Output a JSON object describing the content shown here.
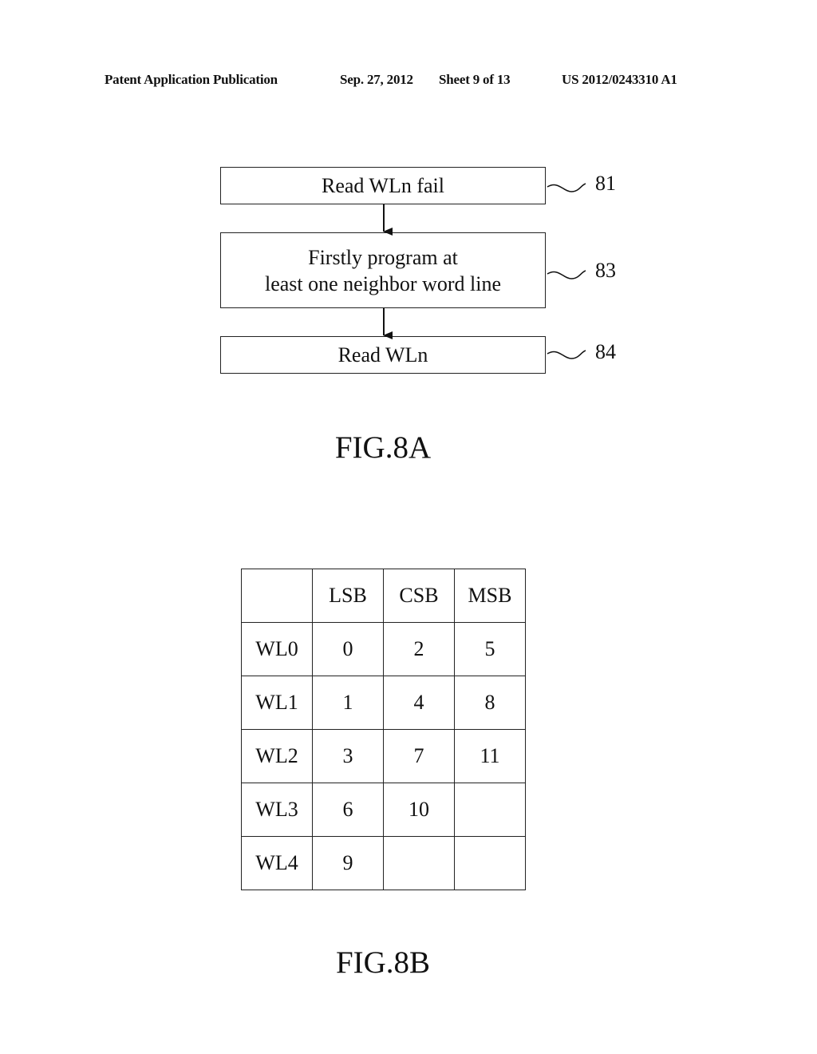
{
  "header": {
    "publication": "Patent Application Publication",
    "date": "Sep. 27, 2012",
    "sheet": "Sheet 9 of 13",
    "number": "US 2012/0243310 A1"
  },
  "fig8a": {
    "label": "FIG.8A",
    "steps": [
      {
        "ref": "81",
        "lines": [
          "Read WLn fail"
        ]
      },
      {
        "ref": "83",
        "lines": [
          "Firstly program at",
          "least one neighbor word line"
        ]
      },
      {
        "ref": "84",
        "lines": [
          "Read WLn"
        ]
      }
    ]
  },
  "fig8b": {
    "label": "FIG.8B",
    "columns": [
      "",
      "LSB",
      "CSB",
      "MSB"
    ],
    "rows": [
      [
        "WL0",
        "0",
        "2",
        "5"
      ],
      [
        "WL1",
        "1",
        "4",
        "8"
      ],
      [
        "WL2",
        "3",
        "7",
        "11"
      ],
      [
        "WL3",
        "6",
        "10",
        ""
      ],
      [
        "WL4",
        "9",
        "",
        ""
      ]
    ]
  }
}
